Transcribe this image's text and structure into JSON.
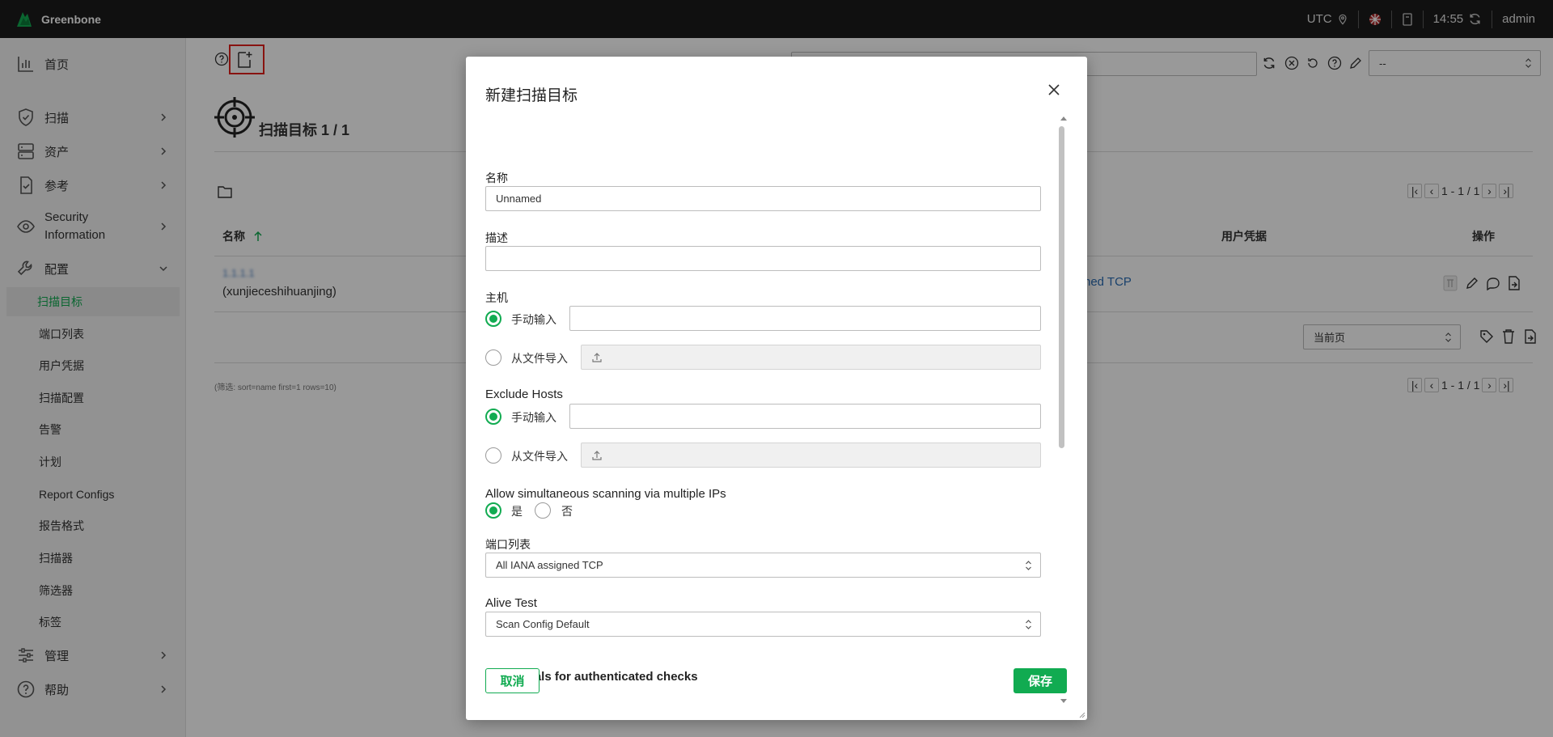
{
  "topbar": {
    "brand": "Greenbone",
    "timezone": "UTC",
    "time": "14:55",
    "user": "admin"
  },
  "sidebar": {
    "items": [
      {
        "label": "首页"
      },
      {
        "label": "扫描"
      },
      {
        "label": "资产"
      },
      {
        "label": "参考"
      },
      {
        "label": "Security Information"
      },
      {
        "label": "配置"
      },
      {
        "label": "管理"
      },
      {
        "label": "帮助"
      }
    ],
    "subitems": [
      "扫描目标",
      "端口列表",
      "用户凭据",
      "扫描配置",
      "告警",
      "计划",
      "Report Configs",
      "报告格式",
      "扫描器",
      "筛选器",
      "标签"
    ]
  },
  "page": {
    "title": "扫描目标 1 / 1",
    "col_name": "名称",
    "col_credentials": "用户凭据",
    "col_actions": "操作",
    "row": {
      "name_blurred": "1.1.1.1",
      "name_comment": "(xunjieceshihuanjing)",
      "port_list_partial": "ned TCP"
    },
    "pager_text": "1 - 1 / 1",
    "bulk_select": "当前页",
    "filter_note": "(筛选: sort=name first=1 rows=10)",
    "filter_select": "--"
  },
  "modal": {
    "title": "新建扫描目标",
    "name_label": "名称",
    "name_value": "Unnamed",
    "desc_label": "描述",
    "hosts_label": "主机",
    "manual_input": "手动输入",
    "from_file": "从文件导入",
    "exclude_label": "Exclude Hosts",
    "simul_label": "Allow simultaneous scanning via multiple IPs",
    "yes": "是",
    "no": "否",
    "port_list_label": "端口列表",
    "port_list_value": "All IANA assigned TCP",
    "alive_label": "Alive Test",
    "alive_value": "Scan Config Default",
    "cred_heading": "Credentials for authenticated checks",
    "cancel": "取消",
    "save": "保存"
  },
  "colors": {
    "accent": "#11ab51",
    "topbar": "#1b1b1b",
    "highlight": "#e3201b"
  }
}
